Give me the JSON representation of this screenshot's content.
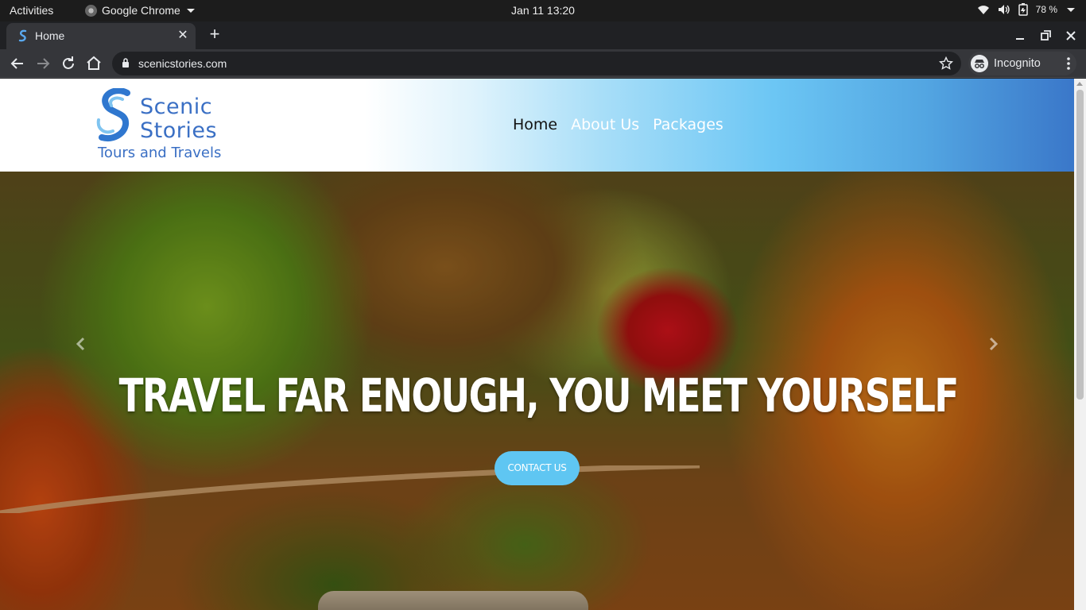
{
  "os": {
    "activities": "Activities",
    "app_name": "Google Chrome",
    "clock": "Jan 11  13:20",
    "battery": "78 %"
  },
  "browser": {
    "tab_title": "Home",
    "url": "scenicstories.com",
    "profile": "Incognito"
  },
  "site": {
    "brand_line1": "Scenic",
    "brand_line2": "Stories",
    "tagline": "Tours and Travels",
    "nav": [
      {
        "label": "Home",
        "active": true
      },
      {
        "label": "About Us",
        "active": false
      },
      {
        "label": "Packages",
        "active": false
      }
    ],
    "hero": {
      "headline": "TRAVEL FAR ENOUGH, YOU MEET YOURSELF",
      "cta_label": "CONTACT US"
    }
  },
  "colors": {
    "brand_blue": "#3a6fc4",
    "cta_blue": "#5fc6f2",
    "header_gradient_end": "#3a77c9"
  },
  "icons": [
    "back-icon",
    "forward-icon",
    "reload-icon",
    "home-icon",
    "lock-icon",
    "star-icon",
    "incognito-icon",
    "kebab-menu-icon",
    "wifi-icon",
    "volume-icon",
    "battery-icon",
    "chevron-left-icon",
    "chevron-right-icon"
  ]
}
